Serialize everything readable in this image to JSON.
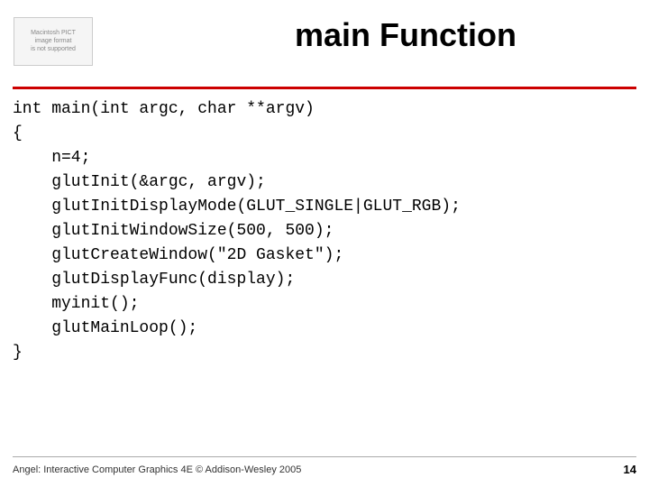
{
  "slide": {
    "title": "main Function",
    "image_placeholder_text": "Macintosh PICT\nimage format\nis not supported",
    "divider_color": "#cc0000",
    "code": {
      "lines": [
        "int main(int argc, char **argv)",
        "{",
        "    n=4;",
        "    glutInit(&argc, argv);",
        "    glutInitDisplayMode(GLUT_SINGLE|GLUT_RGB);",
        "    glutInitWindowSize(500, 500);",
        "    glutCreateWindow(\"2D Gasket\");",
        "    glutDisplayFunc(display);",
        "    myinit();",
        "    glutMainLoop();",
        "}"
      ]
    },
    "footer": {
      "text": "Angel: Interactive Computer Graphics 4E © Addison-Wesley 2005",
      "page": "14"
    }
  }
}
